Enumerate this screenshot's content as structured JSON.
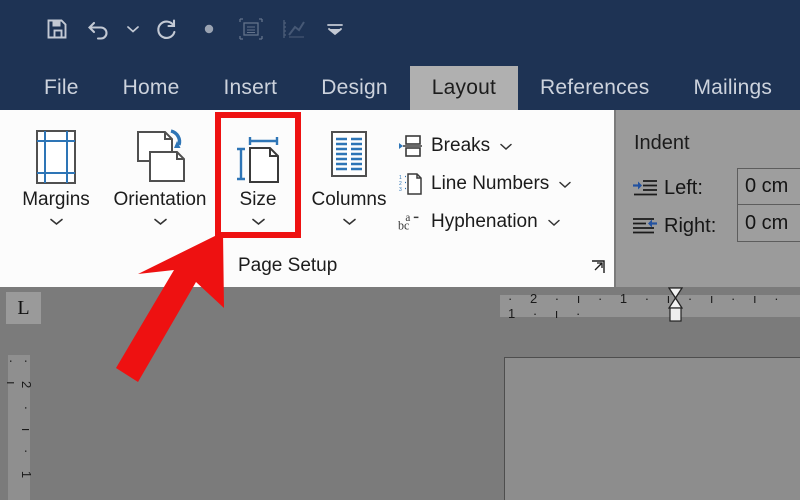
{
  "theme": {
    "titlebar_color": "#1e3354",
    "ribbon_bg": "#fcfcfc",
    "active_tab_bg": "#b0b0b0",
    "highlight_color": "#ee1111",
    "accent_blue": "#2e75b6",
    "workspace_gray": "#7b7b7b"
  },
  "quick_access": {
    "items": [
      {
        "name": "save-icon",
        "label": "Save"
      },
      {
        "name": "undo-icon",
        "label": "Undo"
      },
      {
        "name": "undo-dropdown-icon",
        "label": "Undo options"
      },
      {
        "name": "redo-icon",
        "label": "Redo"
      },
      {
        "name": "dot-icon",
        "label": "Touch Mode"
      },
      {
        "name": "table-properties-icon",
        "label": "Table Properties"
      },
      {
        "name": "chart-edit-icon",
        "label": "Edit Data"
      },
      {
        "name": "customize-qat-icon",
        "label": "Customize Quick Access Toolbar"
      }
    ]
  },
  "tabs": [
    {
      "label": "File",
      "active": false
    },
    {
      "label": "Home",
      "active": false
    },
    {
      "label": "Insert",
      "active": false
    },
    {
      "label": "Design",
      "active": false
    },
    {
      "label": "Layout",
      "active": true
    },
    {
      "label": "References",
      "active": false
    },
    {
      "label": "Mailings",
      "active": false
    }
  ],
  "ribbon": {
    "group_title": "Page Setup",
    "dialog_launcher_name": "page-setup-dialog-launcher",
    "large_buttons": [
      {
        "label": "Margins",
        "icon": "margins-icon",
        "has_dropdown": true,
        "highlighted": false
      },
      {
        "label": "Orientation",
        "icon": "orientation-icon",
        "has_dropdown": true,
        "highlighted": false
      },
      {
        "label": "Size",
        "icon": "size-icon",
        "has_dropdown": true,
        "highlighted": true
      },
      {
        "label": "Columns",
        "icon": "columns-icon",
        "has_dropdown": true,
        "highlighted": false
      }
    ],
    "small_buttons": [
      {
        "label": "Breaks",
        "icon": "breaks-icon",
        "has_dropdown": true
      },
      {
        "label": "Line Numbers",
        "icon": "line-numbers-icon",
        "has_dropdown": true
      },
      {
        "label": "Hyphenation",
        "icon": "hyphenation-icon",
        "has_dropdown": true
      }
    ]
  },
  "indent_group": {
    "title": "Indent",
    "rows": [
      {
        "label": "Left:",
        "value": "0 cm",
        "icon": "indent-left-icon"
      },
      {
        "label": "Right:",
        "value": "0 cm",
        "icon": "indent-right-icon"
      }
    ]
  },
  "annotation": {
    "highlight_target": "Size",
    "arrow_name": "red-pointer-arrow",
    "arrow_color": "#ee1111"
  },
  "document": {
    "tab_stop_selector": "L",
    "horizontal_ruler_marks": "· 2 · ı · 1 · ı · ı · ı · 1 · ı ·",
    "vertical_ruler_marks": "· 2 · ı · 1 · ı",
    "page_name": "document-page"
  }
}
